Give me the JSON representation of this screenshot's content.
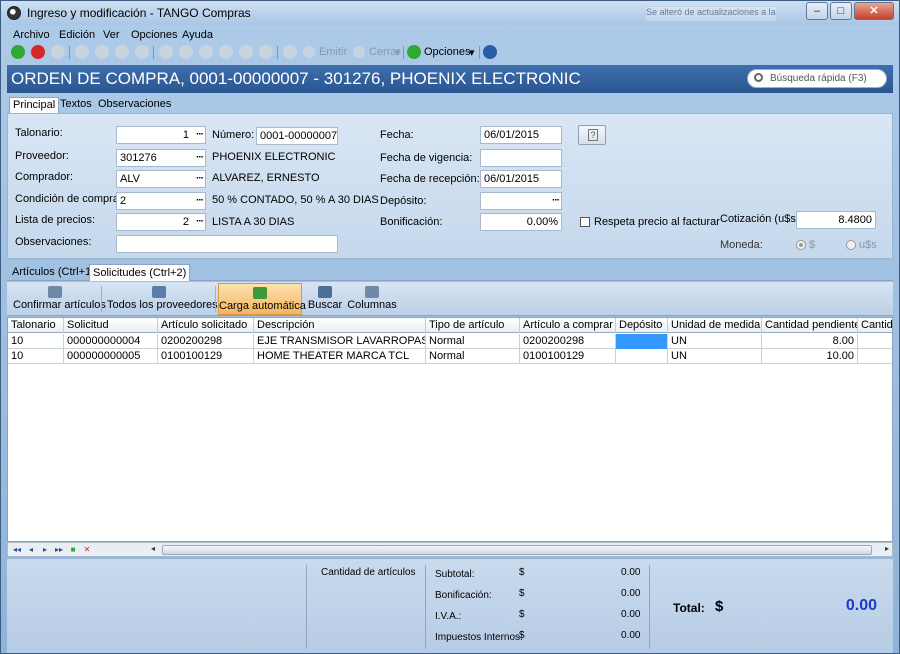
{
  "window": {
    "title": "Ingreso y modificación - TANGO Compras",
    "notification": "Se alteró de actualizaciones a la oferta"
  },
  "menubar": {
    "items": [
      "Archivo",
      "Edición",
      "Ver",
      "Opciones",
      "Ayuda"
    ]
  },
  "toolbar": {
    "emitir": "Emitir",
    "cerrar": "Cerrar",
    "opciones": "Opciones"
  },
  "header": {
    "title": "ORDEN DE COMPRA,   0001-00000007 - 301276, PHOENIX ELECTRONIC",
    "search_placeholder": "Búsqueda rápida (F3)"
  },
  "tabs": [
    "Principal",
    "Textos",
    "Observaciones"
  ],
  "form": {
    "talonario_label": "Talonario:",
    "talonario_value": "1",
    "numero_label": "Número:",
    "numero_value": "0001-00000007",
    "proveedor_label": "Proveedor:",
    "proveedor_value": "301276",
    "proveedor_name": "PHOENIX ELECTRONIC",
    "comprador_label": "Comprador:",
    "comprador_value": "ALV",
    "comprador_name": "ALVAREZ, ERNESTO",
    "condicion_label": "Condición de compra:",
    "condicion_value": "2",
    "condicion_desc": "50 % CONTADO, 50 % A 30 DIAS",
    "lista_label": "Lista de precios:",
    "lista_value": "2",
    "lista_desc": "LISTA A 30 DIAS",
    "observaciones_label": "Observaciones:",
    "observaciones_value": "",
    "fecha_label": "Fecha:",
    "fecha_value": "06/01/2015",
    "vigencia_label": "Fecha de vigencia:",
    "vigencia_value": "",
    "recepcion_label": "Fecha de recepción:",
    "recepcion_value": "06/01/2015",
    "deposito_label": "Depósito:",
    "deposito_value": "",
    "bonificacion_label": "Bonificación:",
    "bonificacion_value": "0.00%",
    "respeta_label": "Respeta precio al facturar",
    "respeta_checked": false,
    "cotizacion_label": "Cotización (u$s):",
    "cotizacion_value": "8.4800",
    "moneda_label": "Moneda:",
    "moneda_options": [
      "$",
      "u$s"
    ],
    "moneda_selected": "$"
  },
  "subtabs": [
    "Artículos (Ctrl+1)",
    "Solicitudes (Ctrl+2)"
  ],
  "actions": [
    "Confirmar artículos",
    "Todos los proveedores",
    "Carga automática",
    "Buscar",
    "Columnas"
  ],
  "grid": {
    "columns": [
      "Talonario",
      "Solicitud",
      "Artículo solicitado",
      "Descripción",
      "Tipo de artículo",
      "Artículo a comprar",
      "Depósito",
      "Unidad de medida",
      "Cantidad pendiente",
      "Cantidad"
    ],
    "rows": [
      [
        "10",
        "000000000004",
        "0200200298",
        "EJE TRANSMISOR LAVARROPAS",
        "Normal",
        "0200200298",
        "",
        "UN",
        "8.00",
        ""
      ],
      [
        "10",
        "000000000005",
        "0100100129",
        "HOME THEATER MARCA TCL",
        "Normal",
        "0100100129",
        "",
        "UN",
        "10.00",
        ""
      ]
    ]
  },
  "footer": {
    "cantidad_label": "Cantidad de artículos",
    "subtotal_label": "Subtotal:",
    "bonificacion_label": "Bonificación:",
    "iva_label": "I.V.A.:",
    "impuestos_label": "Impuestos Internos:",
    "currency": "$",
    "subtotal": "0.00",
    "bonificacion": "0.00",
    "iva": "0.00",
    "impuestos": "0.00",
    "total_label": "Total:",
    "total_currency": "$",
    "total_value": "0.00"
  }
}
